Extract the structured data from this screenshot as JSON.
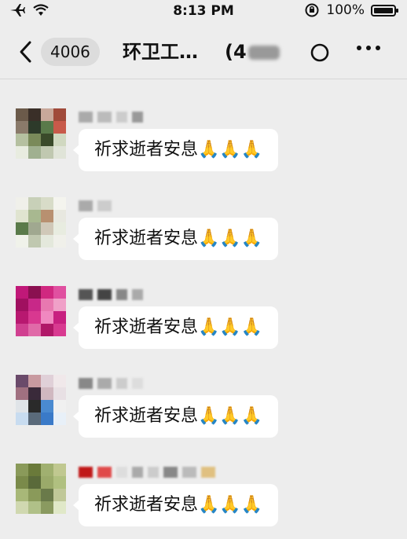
{
  "status_bar": {
    "time": "8:13 PM",
    "battery_text": "100%",
    "icons": [
      "airplane-icon",
      "wifi-icon",
      "orientation-lock-icon",
      "battery-icon"
    ]
  },
  "header": {
    "back_icon": "chevron-left-icon",
    "unread_count": "4006",
    "title": "环卫工…",
    "member_count_prefix": "(4",
    "actions": [
      "circle-icon",
      "more-icon"
    ]
  },
  "messages": [
    {
      "text": "祈求逝者安息🙏🙏🙏",
      "avatar_colors": [
        "#6b5a4a",
        "#3a2f28",
        "#c9a89a",
        "#a04a3a",
        "#8a7a6a",
        "#2d3a2a",
        "#5a7a4a",
        "#c85a4a",
        "#b5c0a0",
        "#7a8a5a",
        "#3a4a2a",
        "#d0d8c0",
        "#e8ece0",
        "#a0b090",
        "#c0c8b0",
        "#e0e4d8"
      ],
      "nick_colors": [
        "#aaaaaa",
        "#bbbbbb",
        "#cccccc",
        "#999999"
      ]
    },
    {
      "text": "祈求逝者安息🙏🙏🙏",
      "avatar_colors": [
        "#f0f0ea",
        "#c8d0b8",
        "#d8dcc8",
        "#f4f4ee",
        "#e0e4d0",
        "#a8b890",
        "#b89070",
        "#e8e8e0",
        "#5a7a4a",
        "#a0a890",
        "#d0c8b8",
        "#e8ece0",
        "#f0f2ea",
        "#c0c8b0",
        "#e4e8dc",
        "#f0f0ea"
      ],
      "nick_colors": [
        "#aaaaaa",
        "#cccccc"
      ]
    },
    {
      "text": "祈求逝者安息🙏🙏🙏",
      "avatar_colors": [
        "#c01878",
        "#8a1050",
        "#d02880",
        "#e050a0",
        "#a01060",
        "#c82888",
        "#e878b0",
        "#f0a0c8",
        "#b81870",
        "#d83890",
        "#f088c0",
        "#c82080",
        "#d04090",
        "#e06aa8",
        "#b01868",
        "#d83a90"
      ],
      "nick_colors": [
        "#555555",
        "#444444",
        "#888888",
        "#aaaaaa"
      ]
    },
    {
      "text": "祈求逝者安息🙏🙏🙏",
      "avatar_colors": [
        "#6a4a6a",
        "#c89aa0",
        "#e0d0d8",
        "#f0e8ea",
        "#a07080",
        "#3a2a3a",
        "#d0b8c0",
        "#e8e0e4",
        "#e0e4e8",
        "#2a2a2a",
        "#4a8ad0",
        "#f0f0f0",
        "#c8dcf0",
        "#5a6a7a",
        "#3a7ac8",
        "#e8f0f8"
      ],
      "nick_colors": [
        "#888888",
        "#aaaaaa",
        "#cccccc",
        "#dddddd"
      ]
    },
    {
      "text": "祈求逝者安息🙏🙏🙏",
      "avatar_colors": [
        "#8a9a5a",
        "#6a7a3a",
        "#a0b070",
        "#c0c890",
        "#7a8a4a",
        "#5a6a3a",
        "#9aaa6a",
        "#b0c080",
        "#a8b878",
        "#8a9a5a",
        "#6a7a4a",
        "#c0c898",
        "#d0d8b0",
        "#b0c088",
        "#8a9a60",
        "#e0e8c8"
      ],
      "nick_colors": [
        "#c01818",
        "#e04a4a",
        "#dddddd",
        "#aaaaaa",
        "#cccccc",
        "#888888",
        "#bbbbbb",
        "#e0c080"
      ]
    }
  ]
}
